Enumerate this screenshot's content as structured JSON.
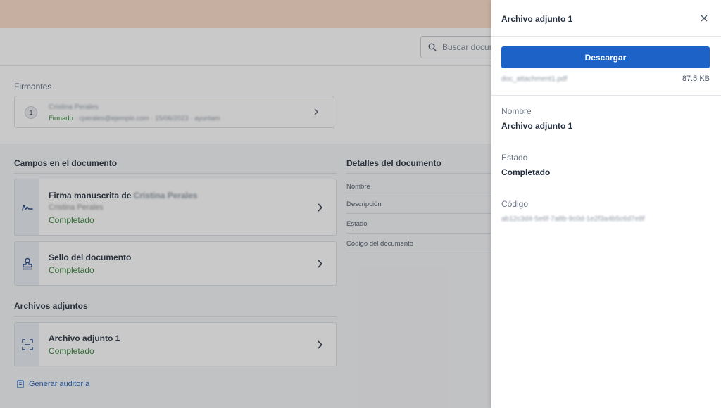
{
  "search": {
    "placeholder": "Buscar documentos"
  },
  "signers": {
    "title": "Firmantes",
    "items": [
      {
        "number": "1",
        "name": "Cristina Perales",
        "status": "Firmado",
        "detail": "· cperales@ejemplo.com · 15/06/2023 · ayuntam"
      }
    ]
  },
  "fields": {
    "title": "Campos en el documento",
    "items": [
      {
        "title": "Firma manuscrita de",
        "title_blurred": "Cristina Perales",
        "subtitle": "Cristina Perales",
        "status": "Completado",
        "icon": "signature-icon"
      },
      {
        "title": "Sello del documento",
        "status": "Completado",
        "icon": "stamp-icon"
      }
    ]
  },
  "attachments": {
    "title": "Archivos adjuntos",
    "items": [
      {
        "title": "Archivo adjunto 1",
        "status": "Completado",
        "icon": "scan-icon"
      }
    ]
  },
  "audit": {
    "label": "Generar auditoría",
    "icon": "document-icon"
  },
  "details": {
    "title": "Detalles del documento",
    "rows": [
      "Nombre",
      "Descripción",
      "Estado",
      "Código del documento"
    ]
  },
  "panel": {
    "title": "Archivo adjunto 1",
    "download_label": "Descargar",
    "file_name": "doc_attachment1.pdf",
    "file_size": "87.5 KB",
    "name_label": "Nombre",
    "name_value": "Archivo adjunto 1",
    "state_label": "Estado",
    "state_value": "Completado",
    "code_label": "Código",
    "code_value": "ab12c3d4-5e6f-7a8b-9c0d-1e2f3a4b5c6d7e8f"
  },
  "colors": {
    "accent": "#1d63c7",
    "success": "#2e7d32",
    "top_band": "#fbdcc6"
  }
}
